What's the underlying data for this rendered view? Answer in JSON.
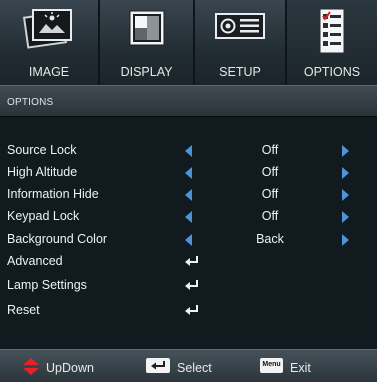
{
  "tabs": [
    {
      "label": "IMAGE",
      "icon": "image-icon",
      "active": false
    },
    {
      "label": "DISPLAY",
      "icon": "display-icon",
      "active": false
    },
    {
      "label": "SETUP",
      "icon": "projector-icon",
      "active": false
    },
    {
      "label": "OPTIONS",
      "icon": "checklist-icon",
      "active": true
    }
  ],
  "header": {
    "title": "OPTIONS"
  },
  "menu": {
    "items": [
      {
        "label": "Source Lock",
        "value": "Off"
      },
      {
        "label": "High Altitude",
        "value": "Off"
      },
      {
        "label": "Information Hide",
        "value": "Off"
      },
      {
        "label": "Keypad Lock",
        "value": "Off"
      },
      {
        "label": "Background Color",
        "value": "Back"
      },
      {
        "label": "Advanced",
        "value": ""
      },
      {
        "label": "Lamp Settings",
        "value": ""
      },
      {
        "label": "Reset",
        "value": ""
      }
    ]
  },
  "footer": {
    "updown_label": "UpDown",
    "select_label": "Select",
    "menu_key": "Menu",
    "exit_label": "Exit"
  },
  "colors": {
    "arrow": "#4d93d8",
    "updown_icon": "#e8202a"
  }
}
